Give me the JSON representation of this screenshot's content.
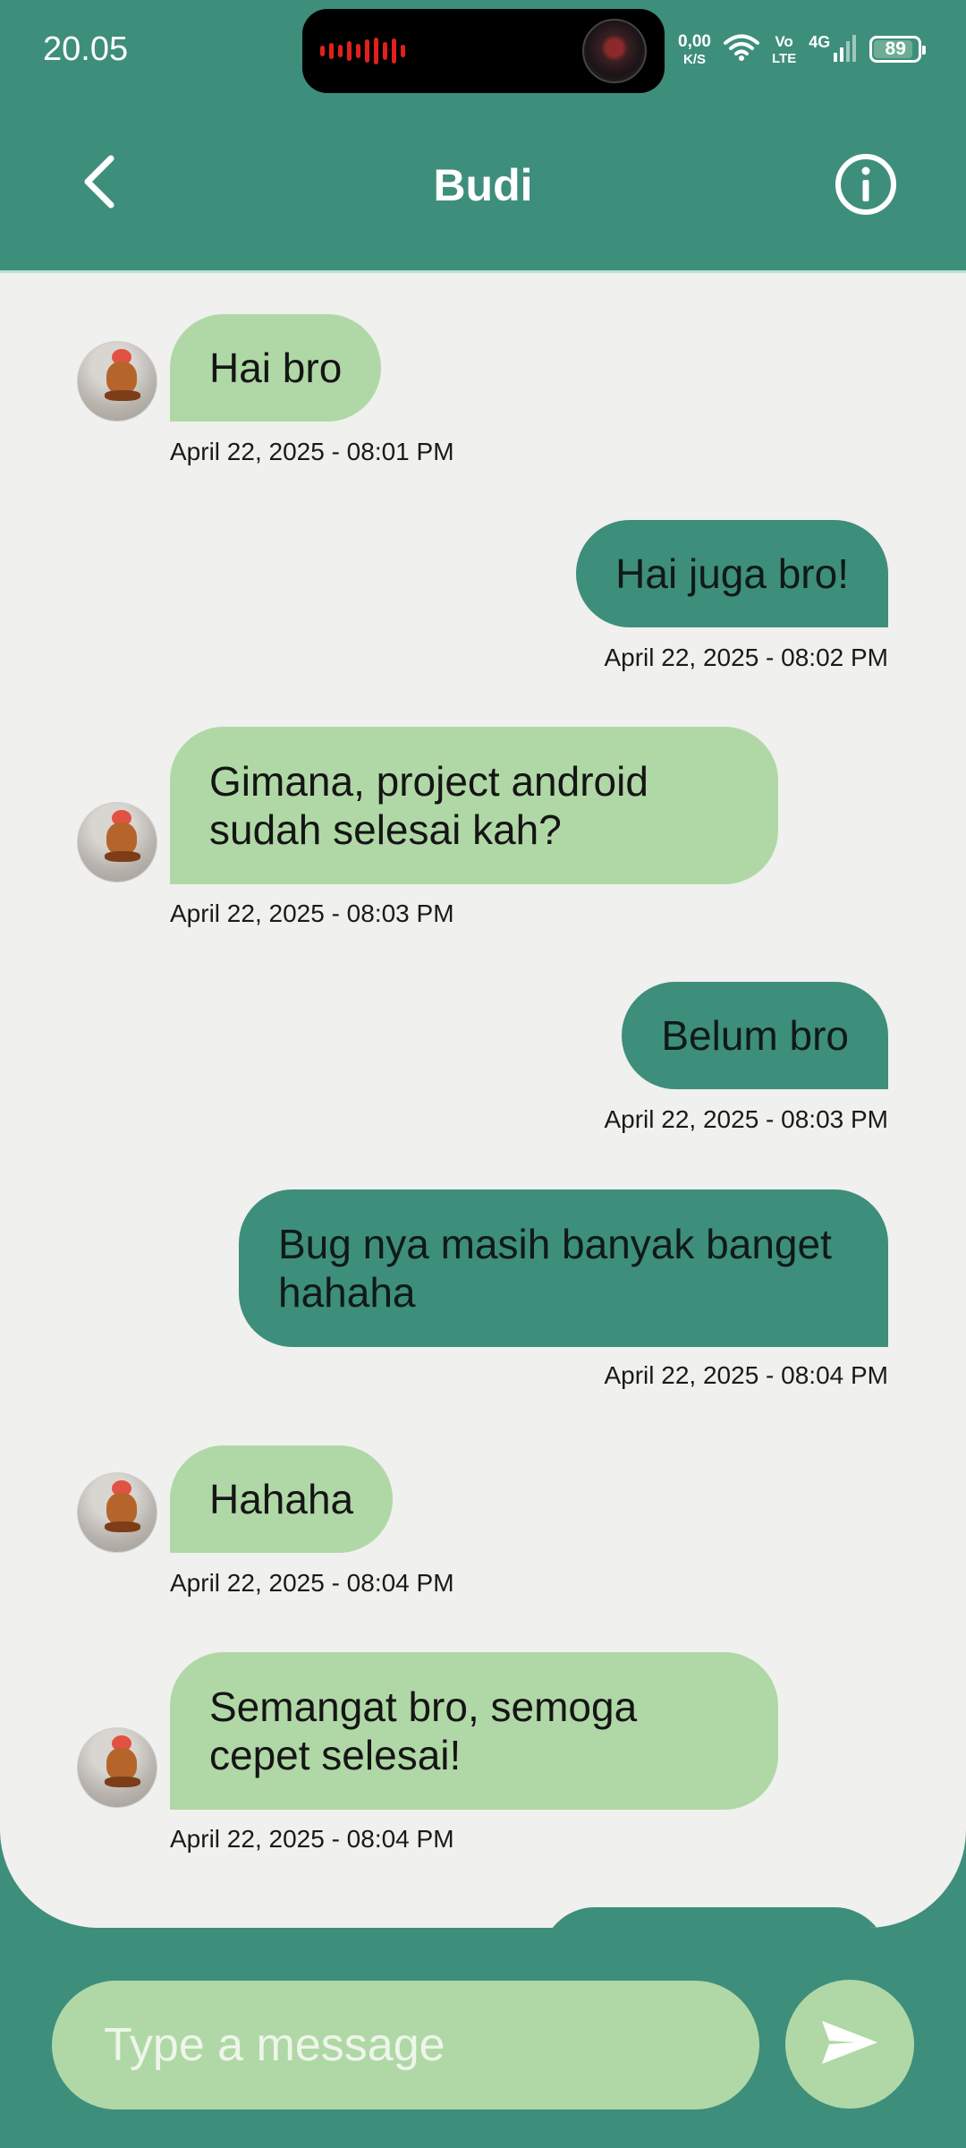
{
  "status_bar": {
    "time": "20.05",
    "net_speed_value": "0,00",
    "net_speed_unit": "K/S",
    "volte_top": "Vo",
    "volte_bottom": "LTE",
    "network_type": "4G",
    "battery": "89",
    "battery_level": 0.89
  },
  "header": {
    "title": "Budi",
    "back_icon": "chevron-left-icon",
    "info_icon": "info-circle-icon"
  },
  "messages": [
    {
      "side": "in",
      "text": "Hai bro",
      "time": "April 22, 2025 - 08:01 PM"
    },
    {
      "side": "out",
      "text": "Hai juga bro!",
      "time": "April 22, 2025 - 08:02 PM"
    },
    {
      "side": "in",
      "text": "Gimana, project android sudah selesai kah?",
      "time": "April 22, 2025 - 08:03 PM"
    },
    {
      "side": "out",
      "text": "Belum bro",
      "time": "April 22, 2025 - 08:03 PM"
    },
    {
      "side": "out",
      "text": "Bug nya masih banyak banget hahaha",
      "time": "April 22, 2025 - 08:04 PM"
    },
    {
      "side": "in",
      "text": "Hahaha",
      "time": "April 22, 2025 - 08:04 PM"
    },
    {
      "side": "in",
      "text": "Semangat bro, semoga cepet selesai!",
      "time": "April 22, 2025 - 08:04 PM"
    }
  ],
  "composer": {
    "placeholder": "Type a message",
    "value": "",
    "send_icon": "send-icon"
  },
  "colors": {
    "primary": "#3e8e7c",
    "incoming_bubble": "#b0d8a6",
    "chat_background": "#f0f0ee"
  }
}
